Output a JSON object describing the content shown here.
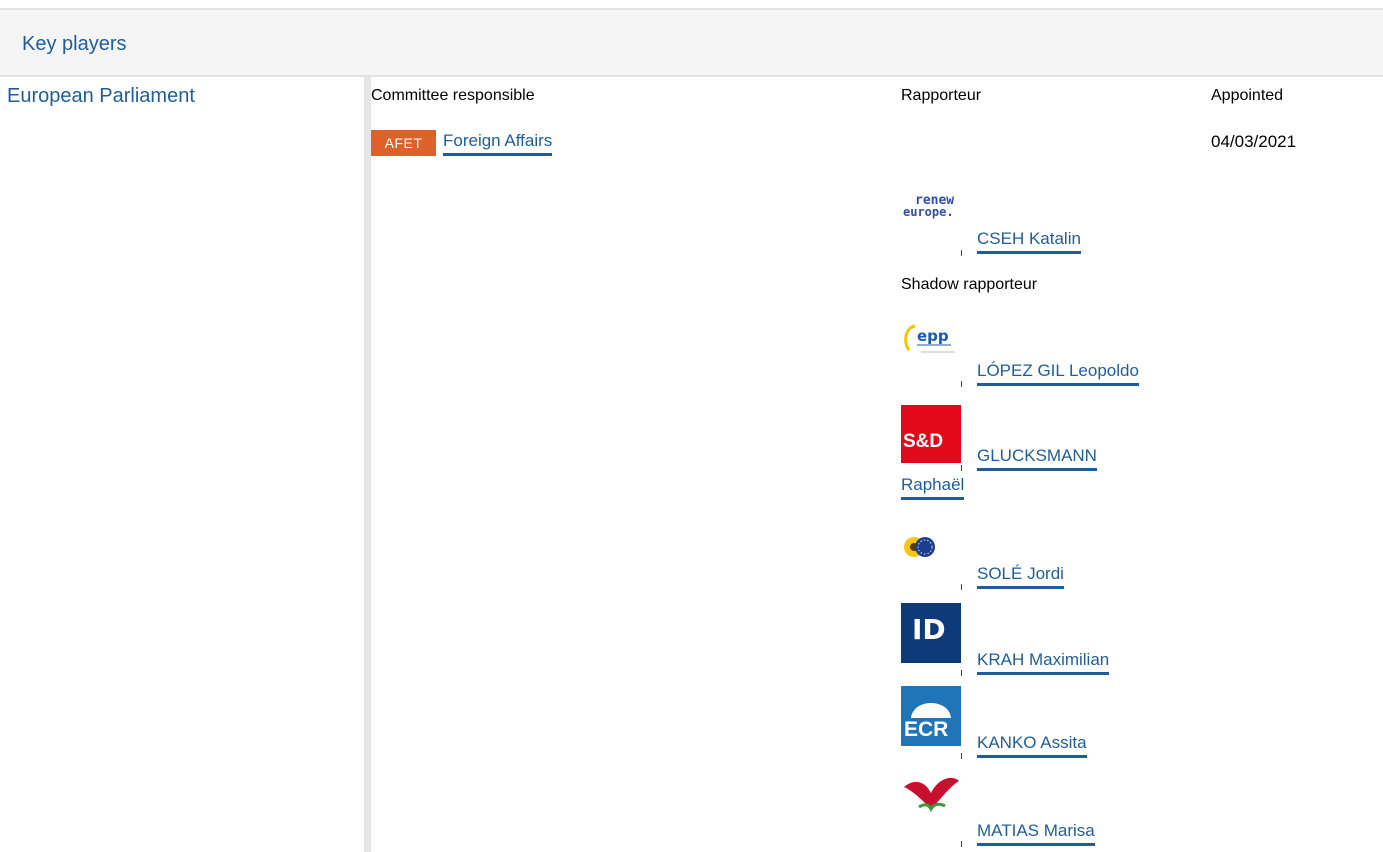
{
  "header": {
    "title": "Key players"
  },
  "institution": {
    "name": "European Parliament"
  },
  "columns": {
    "committee": "Committee responsible",
    "rapporteur": "Rapporteur",
    "appointed": "Appointed"
  },
  "committee": {
    "code": "AFET",
    "name": "Foreign Affairs",
    "appointed": "04/03/2021"
  },
  "rapporteur": {
    "group_logo": "renew-europe-logo",
    "logo_text_1": "renew",
    "logo_text_2": "europe.",
    "name": "CSEH Katalin"
  },
  "shadow_label": "Shadow rapporteur",
  "shadows": [
    {
      "logo": "epp-logo",
      "logo_text": "epp",
      "name": "LÓPEZ GIL Leopoldo"
    },
    {
      "logo": "sd-logo",
      "logo_text": "S&D",
      "name_line1": "GLUCKSMANN",
      "name_line2": "Raphaël"
    },
    {
      "logo": "greens-efa-logo",
      "name": "SOLÉ Jordi"
    },
    {
      "logo": "id-logo",
      "logo_text": "ID",
      "name": "KRAH Maximilian"
    },
    {
      "logo": "ecr-logo",
      "logo_text": "ECR",
      "name": "KANKO Assita"
    },
    {
      "logo": "left-logo",
      "name": "MATIAS Marisa"
    }
  ],
  "colors": {
    "link": "#1f5d99",
    "badge": "#e0602a"
  }
}
